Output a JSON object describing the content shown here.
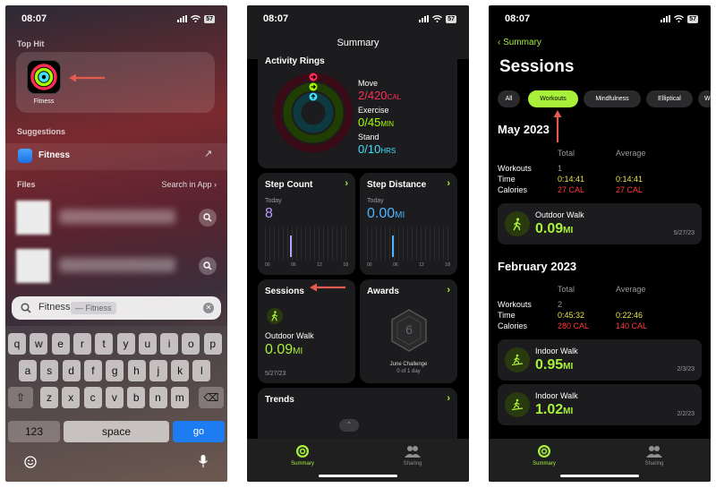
{
  "colors": {
    "move": "#ff2d55",
    "exercise": "#a6ff00",
    "stand": "#40e0ff",
    "accent": "#a8f03a",
    "workouts_yellow": "#e5e54a",
    "calories_red": "#ff3b3b",
    "annotation_arrow": "#e35b4f",
    "ios_blue": "#1e7cf2"
  },
  "status": {
    "time": "08:07",
    "battery": "57"
  },
  "panel1": {
    "top_hit_label": "Top Hit",
    "app_name": "Fitness",
    "suggestions_label": "Suggestions",
    "suggestion_name": "Fitness",
    "files_label": "Files",
    "search_in_app": "Search in App",
    "search_text": "Fitness",
    "search_chip": "— Fitness",
    "keyboard": {
      "row1": [
        "q",
        "w",
        "e",
        "r",
        "t",
        "y",
        "u",
        "i",
        "o",
        "p"
      ],
      "row2": [
        "a",
        "s",
        "d",
        "f",
        "g",
        "h",
        "j",
        "k",
        "l"
      ],
      "row3": [
        "z",
        "x",
        "c",
        "v",
        "b",
        "n",
        "m"
      ],
      "numbers": "123",
      "space": "space",
      "go": "go"
    }
  },
  "panel2": {
    "title": "Summary",
    "activity_rings": {
      "title": "Activity Rings",
      "move_label": "Move",
      "move_value": "2/420",
      "move_unit": "CAL",
      "exercise_label": "Exercise",
      "exercise_value": "0/45",
      "exercise_unit": "MIN",
      "stand_label": "Stand",
      "stand_value": "0/10",
      "stand_unit": "HRS"
    },
    "step_count": {
      "title": "Step Count",
      "period": "Today",
      "value": "8",
      "ticks": [
        "00",
        "06",
        "12",
        "18"
      ]
    },
    "step_distance": {
      "title": "Step Distance",
      "period": "Today",
      "value": "0.00",
      "unit": "MI",
      "ticks": [
        "00",
        "06",
        "12",
        "18"
      ]
    },
    "sessions": {
      "title": "Sessions",
      "workout": "Outdoor Walk",
      "value": "0.09",
      "unit": "MI",
      "date": "5/27/23"
    },
    "awards": {
      "title": "Awards",
      "award_name": "June Challenge",
      "award_progress": "0 of 1 day"
    },
    "trends": {
      "title": "Trends"
    },
    "tabs": {
      "summary": "Summary",
      "sharing": "Sharing"
    }
  },
  "panel3": {
    "back": "Summary",
    "title": "Sessions",
    "filters": [
      "All",
      "Workouts",
      "Mindfulness",
      "Elliptical",
      "W"
    ],
    "col_total": "Total",
    "col_average": "Average",
    "rows": {
      "workouts": "Workouts",
      "time": "Time",
      "calories": "Calories"
    },
    "may": {
      "title": "May 2023",
      "workouts_total": "1",
      "time_total": "0:14:41",
      "time_avg": "0:14:41",
      "cal_total": "27 CAL",
      "cal_avg": "27 CAL",
      "items": [
        {
          "name": "Outdoor Walk",
          "value": "0.09",
          "unit": "MI",
          "date": "5/27/23"
        }
      ]
    },
    "feb": {
      "title": "February 2023",
      "workouts_total": "2",
      "time_total": "0:45:32",
      "time_avg": "0:22:46",
      "cal_total": "280 CAL",
      "cal_avg": "140 CAL",
      "items": [
        {
          "name": "Indoor Walk",
          "value": "0.95",
          "unit": "MI",
          "date": "2/3/23"
        },
        {
          "name": "Indoor Walk",
          "value": "1.02",
          "unit": "MI",
          "date": "2/2/23"
        }
      ]
    },
    "tabs": {
      "summary": "Summary",
      "sharing": "Sharing"
    }
  }
}
